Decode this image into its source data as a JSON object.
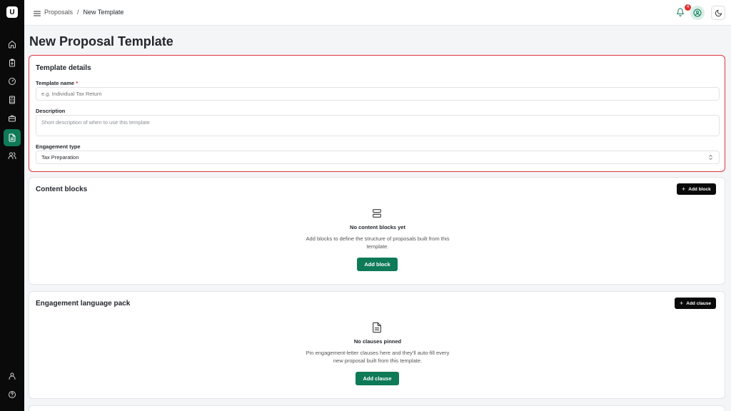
{
  "sidebar": {
    "logo_text": "U",
    "items": [
      {
        "icon": "home-icon"
      },
      {
        "icon": "clipboard-icon"
      },
      {
        "icon": "gauge-icon"
      },
      {
        "icon": "calculator-icon"
      },
      {
        "icon": "briefcase-icon"
      },
      {
        "icon": "document-icon",
        "active": true
      },
      {
        "icon": "users-icon"
      }
    ],
    "bottom_items": [
      {
        "icon": "user-icon"
      },
      {
        "icon": "help-icon"
      }
    ]
  },
  "topbar": {
    "breadcrumb": [
      "Proposals",
      "/",
      "New Template"
    ],
    "notifications_count": "4"
  },
  "page": {
    "title": "New Proposal Template"
  },
  "template_details": {
    "title": "Template details",
    "name_label": "Template name",
    "required_mark": "*",
    "name_placeholder": "e.g. Individual Tax Return",
    "description_label": "Description",
    "description_placeholder": "Short description of when to use this template",
    "engagement_label": "Engagement type",
    "engagement_value": "Tax Preparation"
  },
  "content_blocks": {
    "title": "Content blocks",
    "add_button": "Add block",
    "empty_title": "No content blocks yet",
    "empty_desc_line1": "Add blocks to define the structure of proposals built from this",
    "empty_desc_line2": "template.",
    "cta": "Add block"
  },
  "language_pack": {
    "title": "Engagement language pack",
    "add_button": "Add clause",
    "empty_title": "No clauses pinned",
    "empty_desc_line1": "Pin engagement-letter clauses here and they'll auto-fill every",
    "empty_desc_line2": "new proposal built from this template.",
    "cta": "Add clause"
  },
  "colors": {
    "accent": "#0f7a57",
    "highlight": "#e2353f",
    "sidebar": "#0a0a0a"
  }
}
